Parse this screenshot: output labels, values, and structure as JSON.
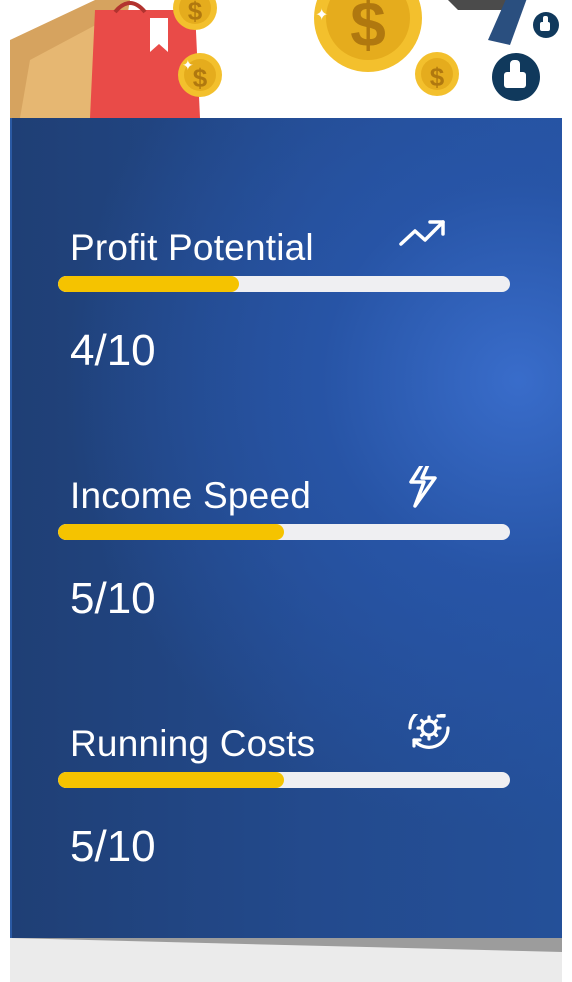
{
  "metrics": [
    {
      "key": "profit",
      "title": "Profit Potential",
      "score": "4/10",
      "level": 0.4,
      "icon": "trending-up-icon"
    },
    {
      "key": "speed",
      "title": "Income Speed",
      "score": "5/10",
      "level": 0.5,
      "icon": "lightning-icon"
    },
    {
      "key": "costs",
      "title": "Running Costs",
      "score": "5/10",
      "level": 0.5,
      "icon": "gear-refresh-icon"
    }
  ],
  "colors": {
    "card_blue": "#234a8d",
    "bar_fill": "#f5c300",
    "bar_track": "#efeff2",
    "text": "#ffffff"
  }
}
